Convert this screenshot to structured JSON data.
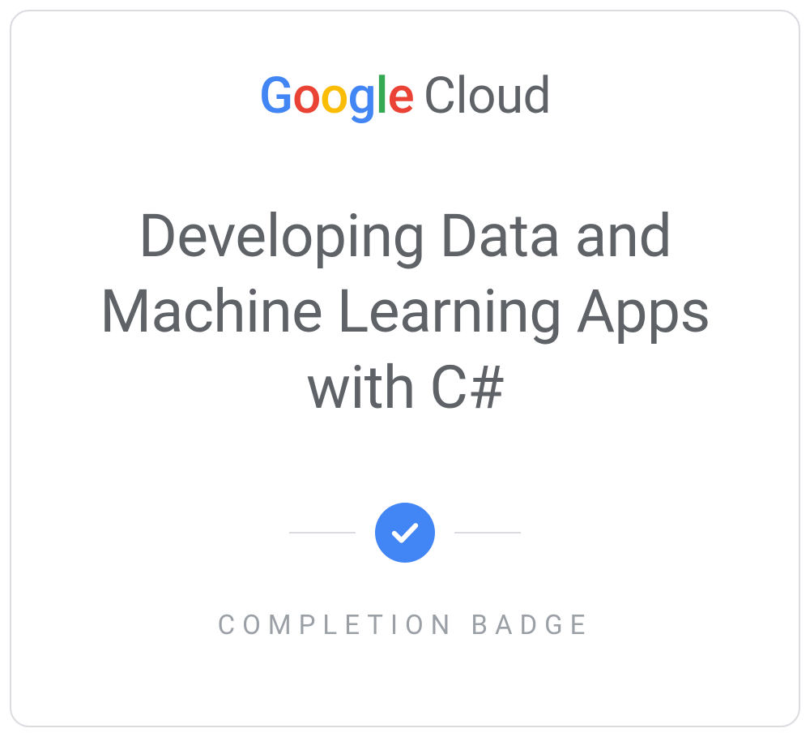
{
  "logo": {
    "google_g1": "G",
    "google_o1": "o",
    "google_o2": "o",
    "google_g2": "g",
    "google_l1": "l",
    "google_e1": "e",
    "cloud": "Cloud"
  },
  "course_title": "Developing Data and Machine Learning Apps with C#",
  "completion_label": "COMPLETION BADGE"
}
